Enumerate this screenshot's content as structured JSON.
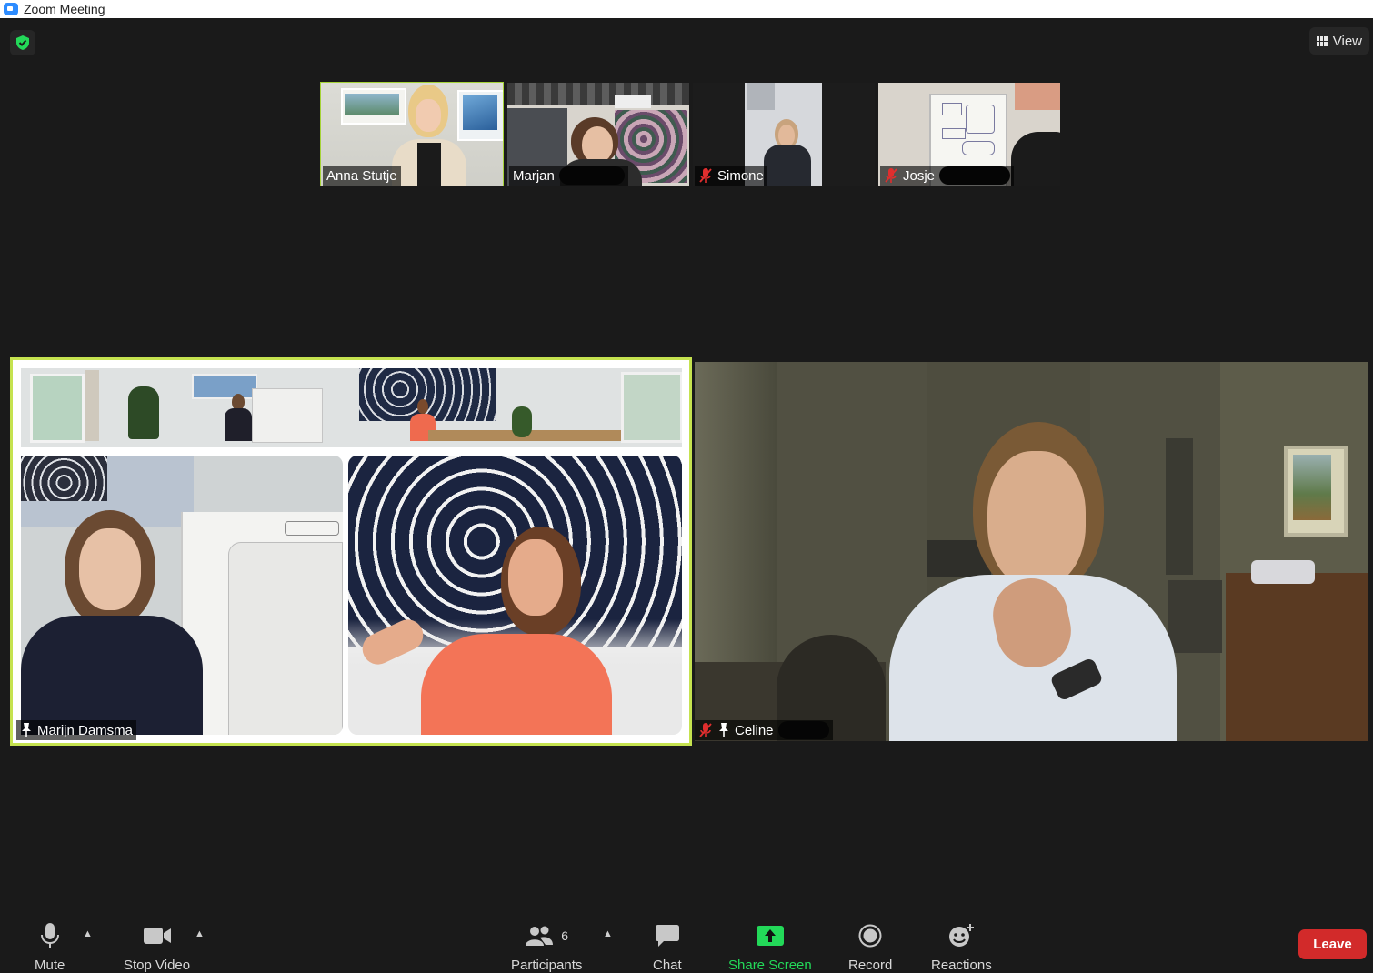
{
  "window": {
    "title": "Zoom Meeting"
  },
  "header": {
    "view_label": "View"
  },
  "thumbnails": [
    {
      "name": "Anna Stutje",
      "muted": false
    },
    {
      "name": "Marjan",
      "muted": false
    },
    {
      "name": "Simone",
      "muted": true
    },
    {
      "name": "Josje",
      "muted": true
    }
  ],
  "main": {
    "left": {
      "name": "Marijn Damsma",
      "muted": false,
      "pinned": true
    },
    "right": {
      "name": "Celine",
      "muted": true,
      "pinned": true
    }
  },
  "toolbar": {
    "mute_label": "Mute",
    "stop_video_label": "Stop Video",
    "participants_label": "Participants",
    "participants_count": "6",
    "chat_label": "Chat",
    "share_screen_label": "Share Screen",
    "record_label": "Record",
    "reactions_label": "Reactions",
    "leave_label": "Leave"
  },
  "colors": {
    "background": "#1a1a1a",
    "active_speaker": "#c5e24f",
    "share_green": "#23d959",
    "leave_red": "#d22a2a",
    "muted_red": "#e02e2e"
  },
  "icons": [
    "shield-check-icon",
    "grid-view-icon",
    "microphone-icon",
    "video-camera-icon",
    "participants-icon",
    "chat-bubble-icon",
    "share-screen-icon",
    "record-icon",
    "reactions-icon",
    "muted-mic-icon",
    "pin-icon"
  ]
}
